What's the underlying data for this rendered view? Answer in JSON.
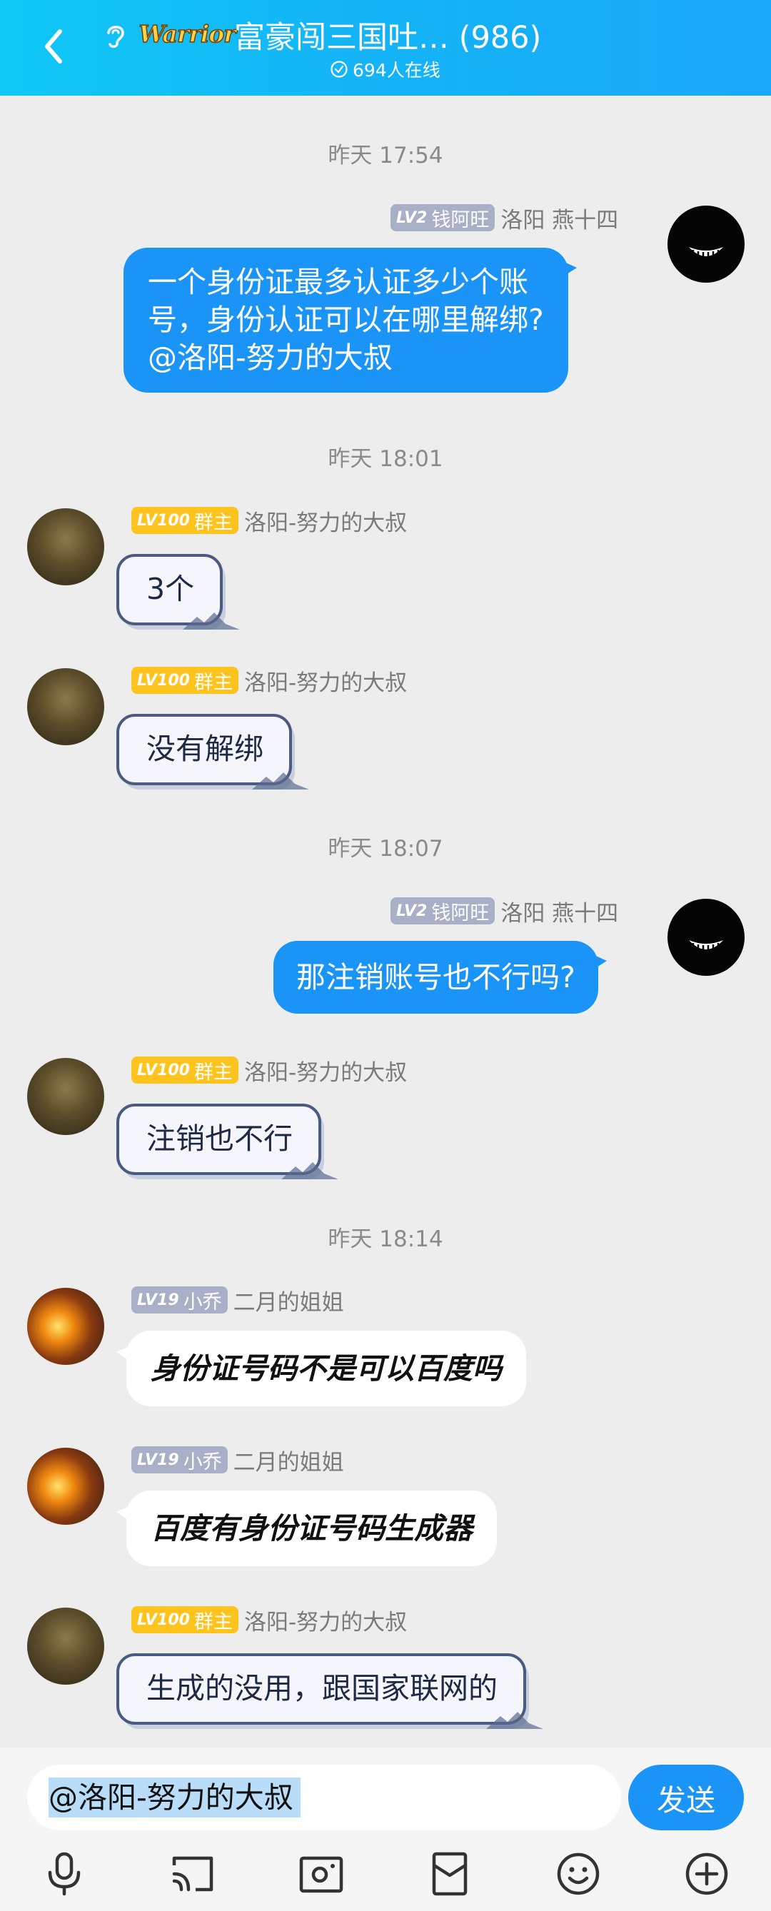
{
  "header": {
    "logo_text": "Warrior",
    "title": "富豪闯三国吐… (986)",
    "online": "694人在线"
  },
  "messages": [
    {
      "time": "昨天 17:54"
    },
    {
      "side": "right",
      "level": "LV2",
      "title": "钱阿旺",
      "nick": "洛阳 燕十四",
      "lines": [
        "一个身份证最多认证多少个账",
        "号，身份认证可以在哪里解绑?",
        "@洛阳-努力的大叔"
      ]
    },
    {
      "time": "昨天 18:01"
    },
    {
      "side": "left",
      "level": "LV100",
      "title": "群主",
      "nick": "洛阳-努力的大叔",
      "text": "3个"
    },
    {
      "side": "left",
      "level": "LV100",
      "title": "群主",
      "nick": "洛阳-努力的大叔",
      "text": "没有解绑"
    },
    {
      "time": "昨天 18:07"
    },
    {
      "side": "right",
      "level": "LV2",
      "title": "钱阿旺",
      "nick": "洛阳 燕十四",
      "text": "那注销账号也不行吗?"
    },
    {
      "side": "left",
      "level": "LV100",
      "title": "群主",
      "nick": "洛阳-努力的大叔",
      "text": "注销也不行"
    },
    {
      "time": "昨天 18:14"
    },
    {
      "side": "left",
      "level": "LV19",
      "title": "小乔",
      "nick": "二月的姐姐",
      "text": "身份证号码不是可以百度吗"
    },
    {
      "side": "left",
      "level": "LV19",
      "title": "小乔",
      "nick": "二月的姐姐",
      "text": "百度有身份证号码生成器"
    },
    {
      "side": "left",
      "level": "LV100",
      "title": "群主",
      "nick": "洛阳-努力的大叔",
      "text": "生成的没用，跟国家联网的"
    }
  ],
  "input": {
    "value": "@洛阳-努力的大叔",
    "send_label": "发送"
  },
  "toolbar": [
    "mic-icon",
    "cast-icon",
    "photo-icon",
    "redpacket-icon",
    "emoji-icon",
    "plus-icon"
  ],
  "colors": {
    "header_gradient_start": "#10c8f6",
    "header_gradient_end": "#1ba8f7",
    "bubble_blue": "#1a94f7",
    "owner_tag": "#ffc31e",
    "member_tag": "#a9afc6",
    "background": "#ededed"
  }
}
